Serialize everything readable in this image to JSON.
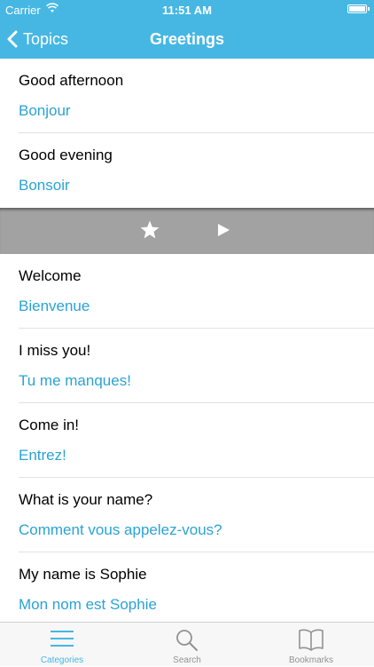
{
  "status_bar": {
    "carrier": "Carrier",
    "time": "11:51 AM"
  },
  "nav": {
    "back_label": "Topics",
    "title": "Greetings"
  },
  "phrases_top": [
    {
      "english": "Good afternoon",
      "french": "Bonjour"
    },
    {
      "english": "Good evening",
      "french": "Bonsoir"
    }
  ],
  "phrases_bottom": [
    {
      "english": "Welcome",
      "french": "Bienvenue"
    },
    {
      "english": "I miss you!",
      "french": "Tu me manques!"
    },
    {
      "english": "Come in!",
      "french": "Entrez!"
    },
    {
      "english": "What is your name?",
      "french": "Comment vous appelez-vous?"
    },
    {
      "english": "My name is Sophie",
      "french": "Mon nom est Sophie"
    }
  ],
  "action_bar": {
    "icons": [
      "star-icon",
      "play-icon"
    ]
  },
  "tabs": [
    {
      "label": "Categories",
      "icon": "list-icon",
      "active": true
    },
    {
      "label": "Search",
      "icon": "search-icon",
      "active": false
    },
    {
      "label": "Bookmarks",
      "icon": "book-icon",
      "active": false
    }
  ],
  "colors": {
    "accent": "#46b7e3",
    "translation": "#2aa3d4",
    "action_bar": "#a2a2a2"
  }
}
